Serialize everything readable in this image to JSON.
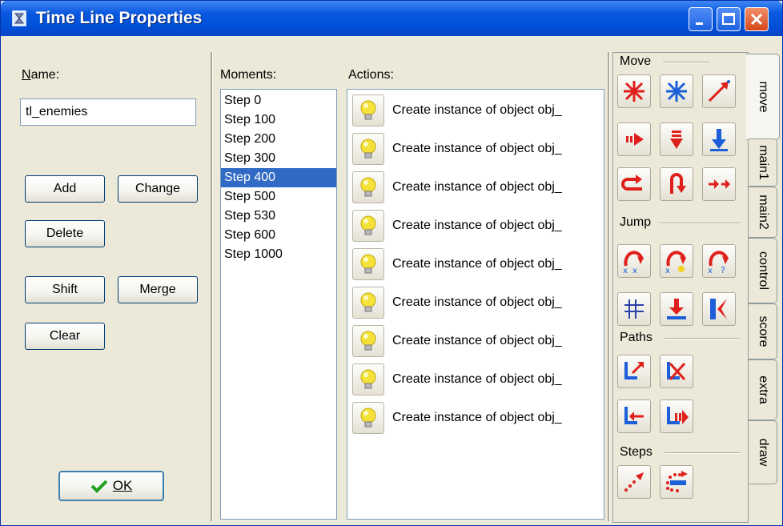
{
  "window": {
    "title": "Time Line Properties"
  },
  "name_label": "Name:",
  "name_value": "tl_enemies",
  "buttons": {
    "add": "Add",
    "change": "Change",
    "delete": "Delete",
    "shift": "Shift",
    "merge": "Merge",
    "clear": "Clear",
    "ok": "OK"
  },
  "moments": {
    "label": "Moments:",
    "items": [
      "Step 0",
      "Step 100",
      "Step 200",
      "Step 300",
      "Step 400",
      "Step 500",
      "Step 530",
      "Step 600",
      "Step 1000"
    ],
    "selected": "Step 400"
  },
  "actions": {
    "label": "Actions:",
    "items": [
      "Create instance of object obj_",
      "Create instance of object obj_",
      "Create instance of object obj_",
      "Create instance of object obj_",
      "Create instance of object obj_",
      "Create instance of object obj_",
      "Create instance of object obj_",
      "Create instance of object obj_",
      "Create instance of object obj_"
    ]
  },
  "action_library": {
    "groups": {
      "move": "Move",
      "jump": "Jump",
      "paths": "Paths",
      "steps": "Steps"
    },
    "tabs": [
      "move",
      "main1",
      "main2",
      "control",
      "score",
      "extra",
      "draw"
    ],
    "active_tab": "move"
  },
  "colors": {
    "title_bar": "#0a58e0",
    "selection": "#316ac5",
    "window_bg": "#ece9d8",
    "ok_check": "#21a121"
  }
}
